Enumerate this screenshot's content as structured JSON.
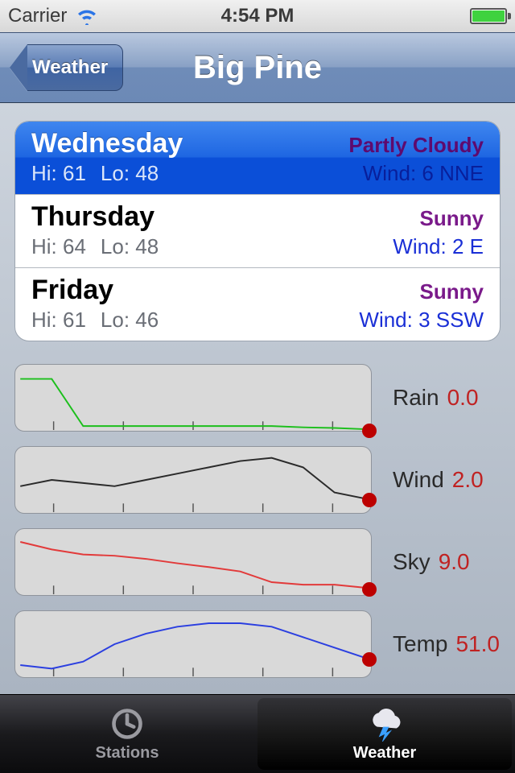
{
  "status": {
    "carrier": "Carrier",
    "time": "4:54 PM"
  },
  "nav": {
    "back_label": "Weather",
    "title": "Big Pine"
  },
  "forecast": [
    {
      "day": "Wednesday",
      "cond": "Partly Cloudy",
      "hi": "Hi: 61",
      "lo": "Lo: 48",
      "wind": "Wind: 6 NNE",
      "selected": true
    },
    {
      "day": "Thursday",
      "cond": "Sunny",
      "hi": "Hi: 64",
      "lo": "Lo: 48",
      "wind": "Wind: 2 E",
      "selected": false
    },
    {
      "day": "Friday",
      "cond": "Sunny",
      "hi": "Hi: 61",
      "lo": "Lo: 46",
      "wind": "Wind: 3 SSW",
      "selected": false
    }
  ],
  "charts": {
    "rain": {
      "label": "Rain",
      "value": "0.0"
    },
    "wind": {
      "label": "Wind",
      "value": "2.0"
    },
    "sky": {
      "label": "Sky",
      "value": "9.0"
    },
    "temp": {
      "label": "Temp",
      "value": "51.0"
    }
  },
  "chart_data": [
    {
      "type": "line",
      "name": "Rain",
      "color": "#1cbf1c",
      "x": [
        0,
        1,
        2,
        3,
        4,
        5,
        6,
        7,
        8,
        9,
        10,
        11
      ],
      "values": [
        80,
        80,
        5,
        5,
        5,
        5,
        5,
        5,
        5,
        3,
        2,
        0
      ],
      "ylim": [
        0,
        100
      ],
      "current": 0.0
    },
    {
      "type": "line",
      "name": "Wind",
      "color": "#2a2a2a",
      "x": [
        0,
        1,
        2,
        3,
        4,
        5,
        6,
        7,
        8,
        9,
        10,
        11
      ],
      "values": [
        4,
        5,
        4.5,
        4,
        5,
        6,
        7,
        8,
        8.5,
        7,
        3,
        2
      ],
      "ylim": [
        0,
        10
      ],
      "current": 2.0
    },
    {
      "type": "line",
      "name": "Sky",
      "color": "#e23a3a",
      "x": [
        0,
        1,
        2,
        3,
        4,
        5,
        6,
        7,
        8,
        9,
        10,
        11
      ],
      "values": [
        82,
        70,
        62,
        60,
        55,
        48,
        42,
        35,
        18,
        14,
        14,
        9
      ],
      "ylim": [
        0,
        100
      ],
      "current": 9.0
    },
    {
      "type": "line",
      "name": "Temp",
      "color": "#2b3fe0",
      "x": [
        0,
        1,
        2,
        3,
        4,
        5,
        6,
        7,
        8,
        9,
        10,
        11
      ],
      "values": [
        49,
        48,
        50,
        55,
        58,
        60,
        61,
        61,
        60,
        57,
        54,
        51
      ],
      "ylim": [
        46,
        64
      ],
      "current": 51.0
    }
  ],
  "tabs": {
    "stations": "Stations",
    "weather": "Weather"
  }
}
